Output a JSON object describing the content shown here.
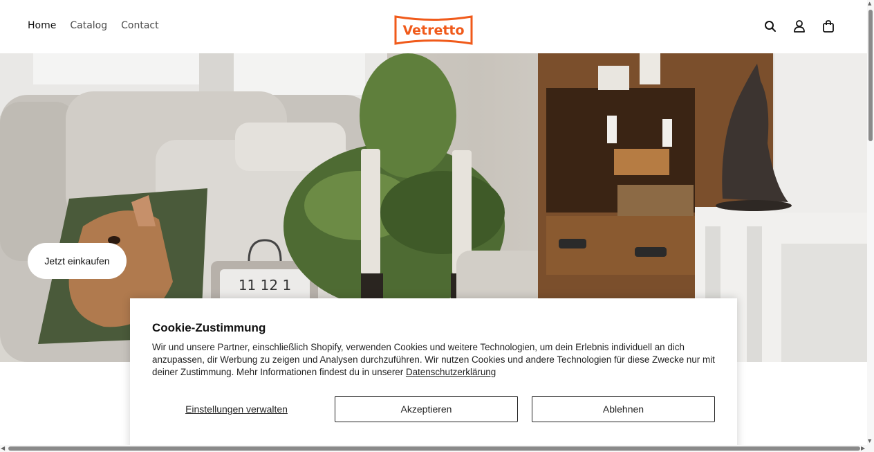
{
  "header": {
    "nav": [
      {
        "label": "Home",
        "active": true
      },
      {
        "label": "Catalog",
        "active": false
      },
      {
        "label": "Contact",
        "active": false
      }
    ],
    "logo_text": "Vetretto",
    "brand_color": "#f05a1a",
    "icons": [
      "search-icon",
      "account-icon",
      "cart-icon"
    ]
  },
  "hero": {
    "button_label": "Jetzt einkaufen",
    "clock_numerals": "11 12 1"
  },
  "cookie": {
    "title": "Cookie-Zustimmung",
    "text": "Wir und unsere Partner, einschließlich Shopify, verwenden Cookies und weitere Technologien, um dein Erlebnis individuell an dich anzupassen, dir Werbung zu zeigen und Analysen durchzuführen. Wir nutzen Cookies und andere Technologien für diese Zwecke nur mit deiner Zustimmung. Mehr Informationen findest du in unserer ",
    "privacy_link": "Datenschutzerklärung",
    "manage_label": "Einstellungen verwalten",
    "accept_label": "Akzeptieren",
    "decline_label": "Ablehnen"
  }
}
